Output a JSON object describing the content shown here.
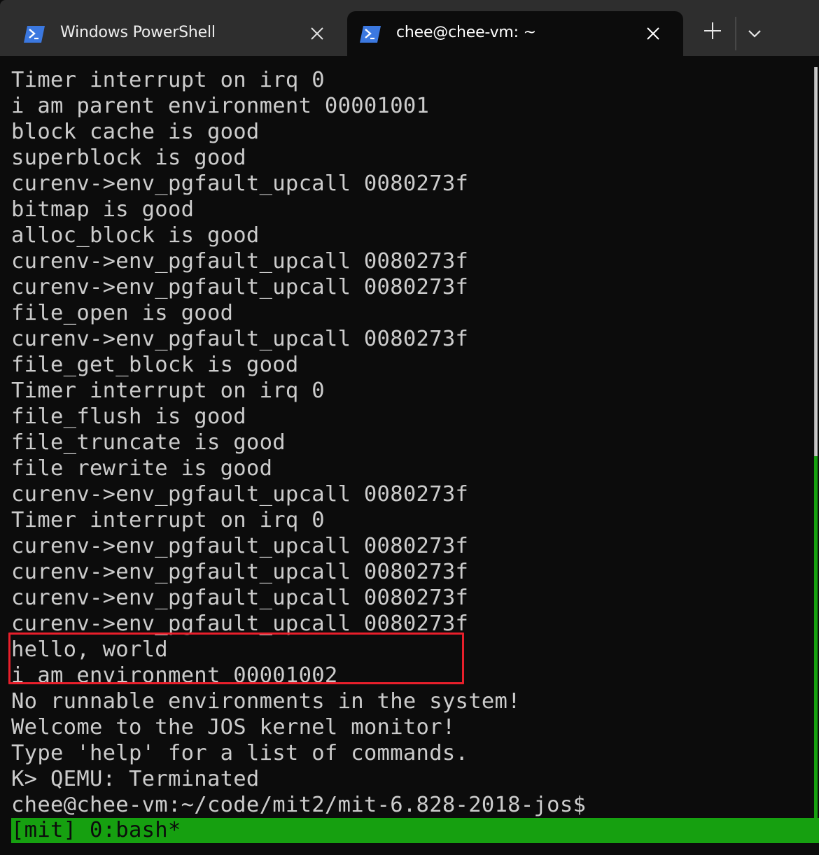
{
  "tabs": [
    {
      "label": "Windows PowerShell",
      "icon": "powershell-icon",
      "active": false
    },
    {
      "label": "chee@chee-vm: ~",
      "icon": "powershell-icon",
      "active": true
    }
  ],
  "tab_controls": {
    "new_tab_icon": "plus-icon",
    "dropdown_icon": "chevron-down-icon"
  },
  "colors": {
    "terminal_bg": "#0c0c0c",
    "terminal_fg": "#cccccc",
    "titlebar_bg": "#2e2e2e",
    "icon_blue": "#3b78e0",
    "tmux_green": "#16a010",
    "highlight_red": "#e81f2b"
  },
  "terminal": {
    "lines": [
      "Timer interrupt on irq 0",
      "i am parent environment 00001001",
      "block cache is good",
      "superblock is good",
      "curenv->env_pgfault_upcall 0080273f",
      "bitmap is good",
      "alloc_block is good",
      "curenv->env_pgfault_upcall 0080273f",
      "curenv->env_pgfault_upcall 0080273f",
      "file_open is good",
      "curenv->env_pgfault_upcall 0080273f",
      "file_get_block is good",
      "Timer interrupt on irq 0",
      "file_flush is good",
      "file_truncate is good",
      "file rewrite is good",
      "curenv->env_pgfault_upcall 0080273f",
      "Timer interrupt on irq 0",
      "curenv->env_pgfault_upcall 0080273f",
      "curenv->env_pgfault_upcall 0080273f",
      "curenv->env_pgfault_upcall 0080273f",
      "curenv->env_pgfault_upcall 0080273f",
      "hello, world",
      "i am environment 00001002",
      "No runnable environments in the system!",
      "Welcome to the JOS kernel monitor!",
      "Type 'help' for a list of commands.",
      "K> QEMU: Terminated",
      "chee@chee-vm:~/code/mit2/mit-6.828-2018-jos$"
    ],
    "highlighted_lines": [
      "hello, world",
      "i am environment 00001002"
    ]
  },
  "tmux": {
    "status": "[mit] 0:bash*"
  }
}
